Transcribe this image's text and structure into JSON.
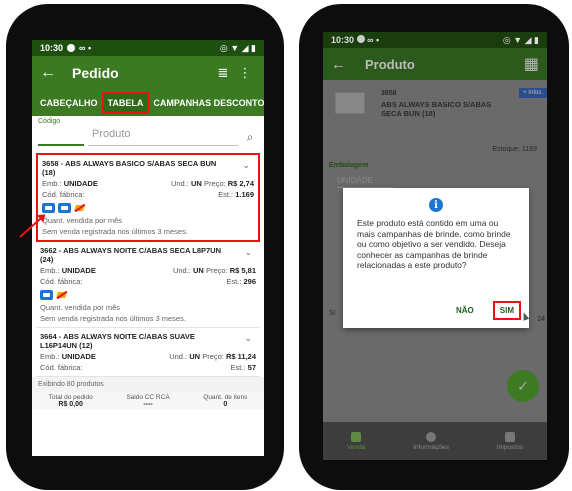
{
  "left": {
    "status": {
      "time": "10:30",
      "extra": "∞ •",
      "icons": "◎ ▼ ◢ ▮"
    },
    "appbar": {
      "back": "←",
      "title": "Pedido",
      "filter": "≣",
      "more": "⋮"
    },
    "tabs": [
      "CABEÇALHO",
      "TABELA",
      "CAMPANHAS DESCONTO"
    ],
    "search": {
      "code_label": "Código",
      "product_placeholder": "Produto",
      "search_icon": "⌕"
    },
    "products": [
      {
        "name": "3658 - ABS ALWAYS BASICO S/ABAS SECA BUN (18)",
        "emb_label": "Emb.:",
        "emb": "UNIDADE",
        "und_label": "Und.:",
        "und": "UN",
        "preco_label": "Preço:",
        "preco": "R$ 2,74",
        "cod_label": "Cód. fábrica:",
        "est_label": "Est.:",
        "est": "1.169",
        "qty": "Quant. vendida por mês",
        "sem": "Sem venda registrada nos últimos 3 meses."
      },
      {
        "name": "3662 - ABS ALWAYS NOITE C/ABAS SECA L8P7UN (24)",
        "emb_label": "Emb.:",
        "emb": "UNIDADE",
        "und_label": "Und.:",
        "und": "UN",
        "preco_label": "Preço:",
        "preco": "R$ 5,81",
        "cod_label": "Cód. fábrica:",
        "est_label": "Est.:",
        "est": "296",
        "qty": "Quant. vendida por mês",
        "sem": "Sem venda registrada nos últimos 3 meses."
      },
      {
        "name": "3664 - ABS ALWAYS NOITE C/ABAS SUAVE L16P14UN (12)",
        "emb_label": "Emb.:",
        "emb": "UNIDADE",
        "und_label": "Und.:",
        "und": "UN",
        "preco_label": "Preço:",
        "preco": "R$ 11,24",
        "cod_label": "Cód. fábrica:",
        "est_label": "Est.:",
        "est": "57"
      }
    ],
    "exibindo": "Exibindo 80 produtos",
    "footer": [
      {
        "label": "Total do pedido",
        "value": "R$ 0,00"
      },
      {
        "label": "Saldo CC RCA",
        "value": "----"
      },
      {
        "label": "Quant. de itens",
        "value": "0"
      }
    ]
  },
  "right": {
    "status": {
      "time": "10:30",
      "extra": "∞ •",
      "icons": "◎ ▼ ◢ ▮"
    },
    "appbar": {
      "back": "←",
      "title": "Produto",
      "calc": "▦"
    },
    "infos": "+ Infos.",
    "code": "3658",
    "name": "ABS ALWAYS BASICO S/ABAS SECA BUN (18)",
    "estoque": "Estoque: 1169",
    "embalagem_label": "Embalagem",
    "embalagem_value": "UNIDADE",
    "side_left": "Si",
    "side_right": "24",
    "dialog": {
      "info_icon": "i",
      "message": "Este produto está contido em uma ou mais campanhas de brinde, como brinde ou como objetivo a ser vendido. Deseja conhecer as campanhas de brinde relacionadas a este produto?",
      "no": "NÃO",
      "yes": "SIM"
    },
    "fab_icon": "✓",
    "bottom_nav": [
      "Venda",
      "Informações",
      "Impostos"
    ]
  }
}
